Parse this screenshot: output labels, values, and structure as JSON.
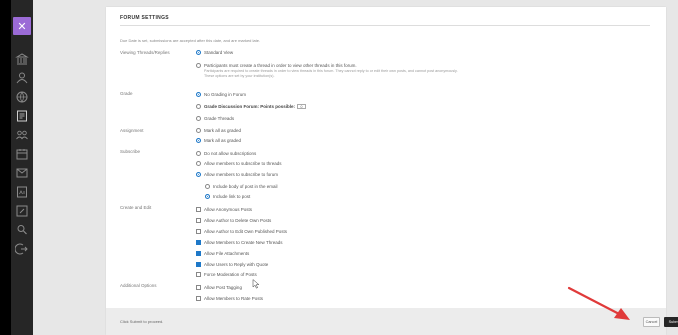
{
  "sidebar": {
    "logo_glyph": "✕",
    "icons": [
      "institution-icon",
      "user-icon",
      "globe-icon",
      "courses-icon",
      "groups-icon",
      "calendar-icon",
      "messages-icon",
      "grades-icon",
      "tools-icon",
      "help-icon",
      "signout-icon"
    ]
  },
  "panel": {
    "title": "FORUM SETTINGS",
    "intro": "Due Date is set, submissions are accepted after this date, and are marked late."
  },
  "sections": {
    "viewing": {
      "label": "Viewing Threads/Replies",
      "options": [
        {
          "text": "Standard View",
          "selected": true
        },
        {
          "text": "Participants must create a thread in order to view other threads in this forum.",
          "selected": false
        }
      ],
      "desc_1": "Participants are required to create threads in order to view threads in this forum. They cannot reply to or edit their own posts, and cannot post anonymously.",
      "desc_2": "These options are set by your institution(s)."
    },
    "grade": {
      "label": "Grade",
      "options": [
        {
          "text": "No Grading in Forum",
          "selected": true
        },
        {
          "text": "Grade Discussion Forum: Points possible:",
          "selected": false,
          "points": "0"
        },
        {
          "text": "Grade Threads",
          "selected": false
        }
      ]
    },
    "subscribe": {
      "label": "Subscribe",
      "options": [
        {
          "text": "Do not allow subscriptions",
          "selected": false
        },
        {
          "text": "Allow members to subscribe to threads",
          "selected": false
        },
        {
          "text": "Allow members to subscribe to forum",
          "selected": true
        }
      ],
      "sub_options": [
        {
          "text": "Include body of post in the email",
          "selected": false
        },
        {
          "text": "Include link to post",
          "selected": true
        }
      ]
    },
    "assignment": {
      "label": "Assignment",
      "options": [
        {
          "text": "Mark all as graded",
          "selected": false
        },
        {
          "text": "Mark all as graded",
          "selected": true
        }
      ]
    },
    "create_edit": {
      "label": "Create and Edit",
      "options": [
        {
          "text": "Allow Anonymous Posts",
          "checked": false
        },
        {
          "text": "Allow Author to Delete Own Posts",
          "checked": false
        },
        {
          "text": "Allow Author to Edit Own Published Posts",
          "checked": false
        },
        {
          "text": "Allow Members to Create New Threads",
          "checked": true
        },
        {
          "text": "Allow File Attachments",
          "checked": true
        },
        {
          "text": "Allow Users to Reply with Quote",
          "checked": true
        },
        {
          "text": "Force Moderation of Posts",
          "checked": false
        }
      ]
    },
    "additional": {
      "label": "Additional Options",
      "options": [
        {
          "text": "Allow Post Tagging",
          "checked": false
        },
        {
          "text": "Allow Members to Rate Posts",
          "checked": false
        }
      ]
    }
  },
  "footer": {
    "text": "Click Submit to proceed.",
    "cancel_label": "Cancel",
    "submit_label": "Submit"
  },
  "colors": {
    "accent": "#1e78c8",
    "annotation_arrow": "#e03a3a",
    "logo": "#9b6bd6"
  }
}
